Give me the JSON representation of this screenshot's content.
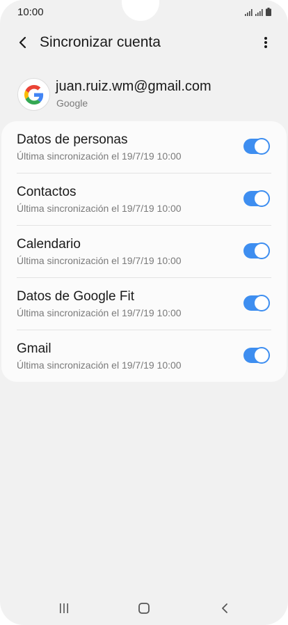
{
  "status_bar": {
    "time": "10:00",
    "icons": [
      "signal-icon",
      "signal-icon",
      "battery-icon"
    ]
  },
  "app_bar": {
    "title": "Sincronizar cuenta",
    "back_icon": "back-arrow-icon",
    "menu_icon": "more-vert-icon"
  },
  "account": {
    "email": "juan.ruiz.wm@gmail.com",
    "type": "Google",
    "avatar_icon": "google-logo-icon"
  },
  "sync_items": [
    {
      "title": "Datos de personas",
      "subtitle": "Última sincronización el 19/7/19  10:00",
      "enabled": true
    },
    {
      "title": "Contactos",
      "subtitle": "Última sincronización el 19/7/19  10:00",
      "enabled": true
    },
    {
      "title": "Calendario",
      "subtitle": "Última sincronización el 19/7/19  10:00",
      "enabled": true
    },
    {
      "title": "Datos de Google Fit",
      "subtitle": "Última sincronización el 19/7/19  10:00",
      "enabled": true
    },
    {
      "title": "Gmail",
      "subtitle": "Última sincronización el 19/7/19  10:00",
      "enabled": true
    }
  ],
  "nav_bar": {
    "icons": [
      "recents-icon",
      "home-icon",
      "back-icon"
    ]
  },
  "colors": {
    "accent": "#3e8ef0",
    "background": "#f1f1f1",
    "card": "#fbfbfb"
  }
}
